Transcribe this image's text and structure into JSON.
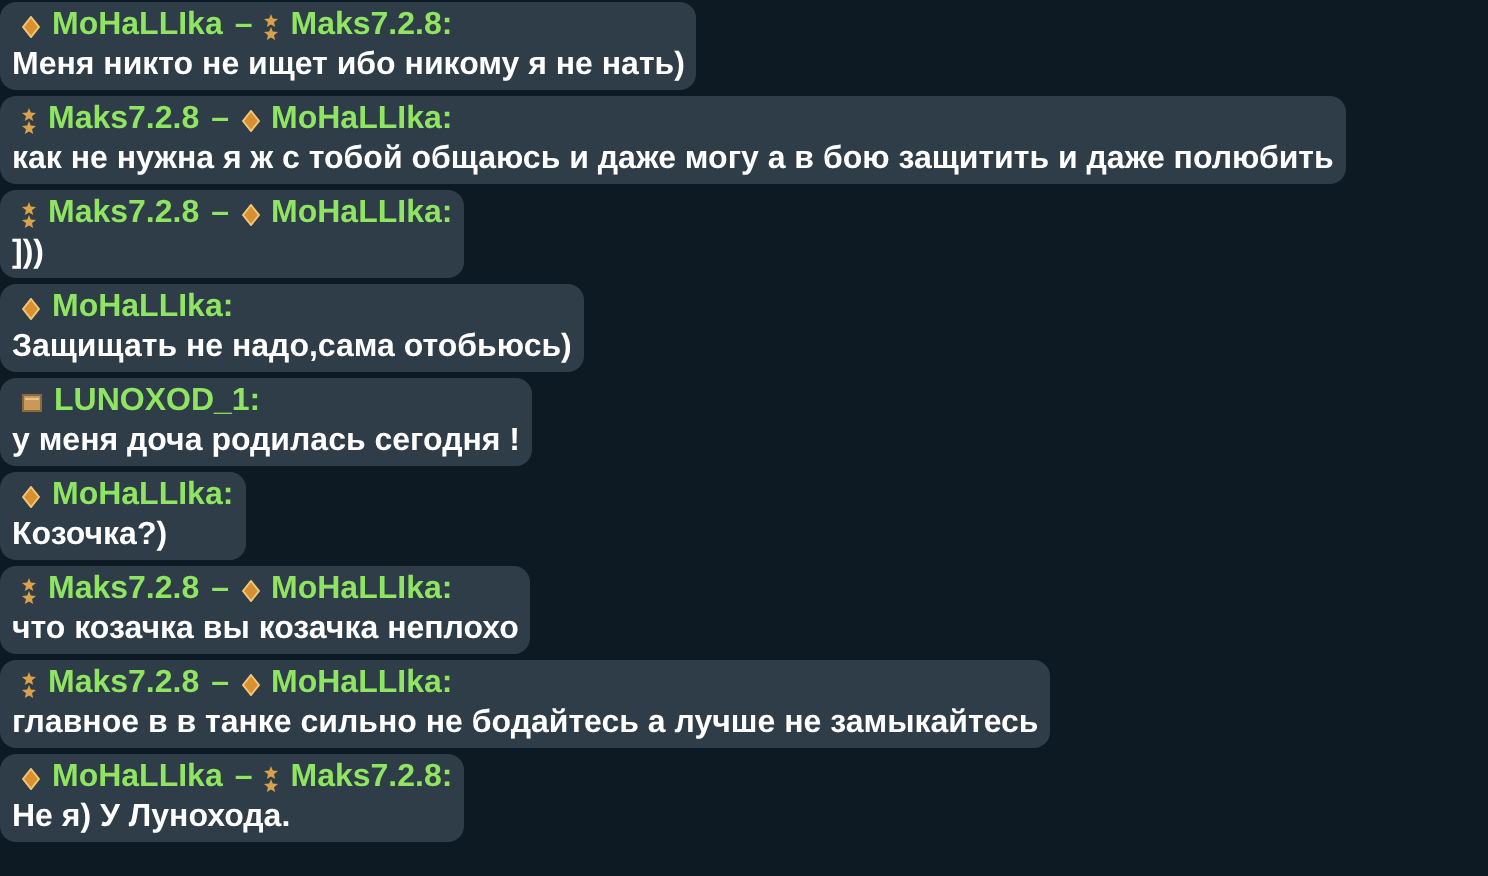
{
  "messages": [
    {
      "header": [
        {
          "kind": "diamond"
        },
        {
          "kind": "name",
          "text": "MoHaLLIka"
        },
        {
          "kind": "separator",
          "text": "–"
        },
        {
          "kind": "stars"
        },
        {
          "kind": "name",
          "text": "Maks7.2.8:"
        }
      ],
      "text": "Меня никто не ищет ибо никому я не нать)"
    },
    {
      "header": [
        {
          "kind": "stars"
        },
        {
          "kind": "name",
          "text": "Maks7.2.8"
        },
        {
          "kind": "separator",
          "text": "–"
        },
        {
          "kind": "diamond"
        },
        {
          "kind": "name",
          "text": "MoHaLLIka:"
        }
      ],
      "text": "как не нужна я ж с тобой общаюсь и даже могу а в бою защитить и даже полюбить"
    },
    {
      "header": [
        {
          "kind": "stars"
        },
        {
          "kind": "name",
          "text": "Maks7.2.8"
        },
        {
          "kind": "separator",
          "text": "–"
        },
        {
          "kind": "diamond"
        },
        {
          "kind": "name",
          "text": "MoHaLLIka:"
        }
      ],
      "text": "]))"
    },
    {
      "header": [
        {
          "kind": "diamond"
        },
        {
          "kind": "name",
          "text": "MoHaLLIka:"
        }
      ],
      "text": "Защищать не надо,сама отобьюсь)"
    },
    {
      "header": [
        {
          "kind": "box"
        },
        {
          "kind": "name",
          "text": "LUNOXOD_1:"
        }
      ],
      "text": "у меня доча родилась сегодня !"
    },
    {
      "header": [
        {
          "kind": "diamond"
        },
        {
          "kind": "name",
          "text": "MoHaLLIka:"
        }
      ],
      "text": "Козочка?)"
    },
    {
      "header": [
        {
          "kind": "stars"
        },
        {
          "kind": "name",
          "text": "Maks7.2.8"
        },
        {
          "kind": "separator",
          "text": "–"
        },
        {
          "kind": "diamond"
        },
        {
          "kind": "name",
          "text": "MoHaLLIka:"
        }
      ],
      "text": "что козачка вы козачка неплохо"
    },
    {
      "header": [
        {
          "kind": "stars"
        },
        {
          "kind": "name",
          "text": "Maks7.2.8"
        },
        {
          "kind": "separator",
          "text": "–"
        },
        {
          "kind": "diamond"
        },
        {
          "kind": "name",
          "text": "MoHaLLIka:"
        }
      ],
      "text": "главное в в танке сильно не бодайтесь а лучше не замыкайтесь"
    },
    {
      "header": [
        {
          "kind": "diamond"
        },
        {
          "kind": "name",
          "text": "MoHaLLIka"
        },
        {
          "kind": "separator",
          "text": "–"
        },
        {
          "kind": "stars"
        },
        {
          "kind": "name",
          "text": "Maks7.2.8:"
        }
      ],
      "text": "Не я) У Лунохода."
    }
  ]
}
